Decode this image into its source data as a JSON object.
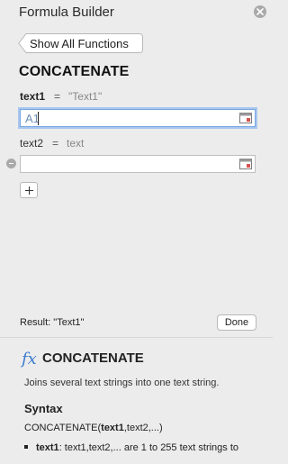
{
  "window": {
    "title": "Formula Builder"
  },
  "nav": {
    "back_label": "Show All Functions"
  },
  "function": {
    "name": "CONCATENATE"
  },
  "args": [
    {
      "name": "text1",
      "equals": "=",
      "hint": "\"Text1\"",
      "value": "A1"
    },
    {
      "name": "text2",
      "equals": "=",
      "hint": "text",
      "value": ""
    }
  ],
  "result": {
    "label": "Result: \"Text1\""
  },
  "buttons": {
    "done_label": "Done"
  },
  "help": {
    "fx_symbol": "fx",
    "title": "CONCATENATE",
    "description": "Joins several text strings into one text string.",
    "syntax_heading": "Syntax",
    "syntax_prefix": "CONCATENATE(",
    "syntax_arg": "text1",
    "syntax_suffix": ",text2,...)",
    "bullet_term": "text1",
    "bullet_text": ": text1,text2,... are 1 to 255 text strings to"
  },
  "colors": {
    "accent": "#3b7bd0",
    "focus_ring": "#a8c7f0",
    "panel_bg": "#ececec"
  }
}
